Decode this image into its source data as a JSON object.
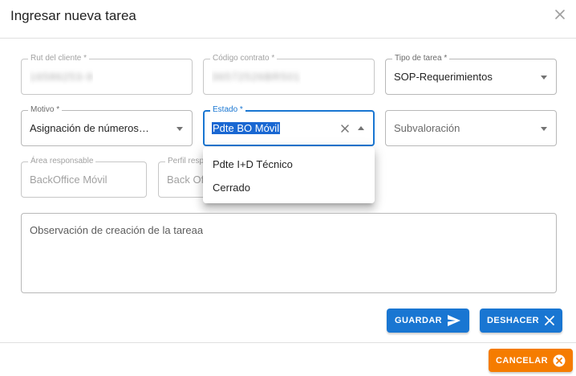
{
  "dialog": {
    "title": "Ingresar nueva tarea"
  },
  "fields": {
    "rut": {
      "label": "Rut del cliente *",
      "value": "16586253-9"
    },
    "codigo": {
      "label": "Código contrato *",
      "value": "36572526BR501"
    },
    "tipo": {
      "label": "Tipo de tarea *",
      "value": "SOP-Requerimientos"
    },
    "motivo": {
      "label": "Motivo *",
      "value": "Asignación de números…"
    },
    "estado": {
      "label": "Estado *",
      "value": "Pdte BO Móvil"
    },
    "subvaloracion": {
      "placeholder": "Subvaloración"
    },
    "area": {
      "label": "Área responsable",
      "value": "BackOffice Móvil"
    },
    "perfil": {
      "label": "Perfil responsable",
      "value": "Back Office"
    },
    "observacion": {
      "placeholder": "Observación de creación de la tareaa"
    }
  },
  "estado_options": [
    "Pdte I+D Técnico",
    "Cerrado"
  ],
  "buttons": {
    "guardar": "GUARDAR",
    "deshacer": "DESHACER",
    "cancelar": "CANCELAR"
  },
  "icons": {
    "close": "close-icon",
    "send": "send-icon",
    "x": "x-icon",
    "cancel": "cancel-circle-icon"
  },
  "colors": {
    "primary": "#1976d2",
    "accent": "#f57c00",
    "selection": "#1967d2"
  }
}
